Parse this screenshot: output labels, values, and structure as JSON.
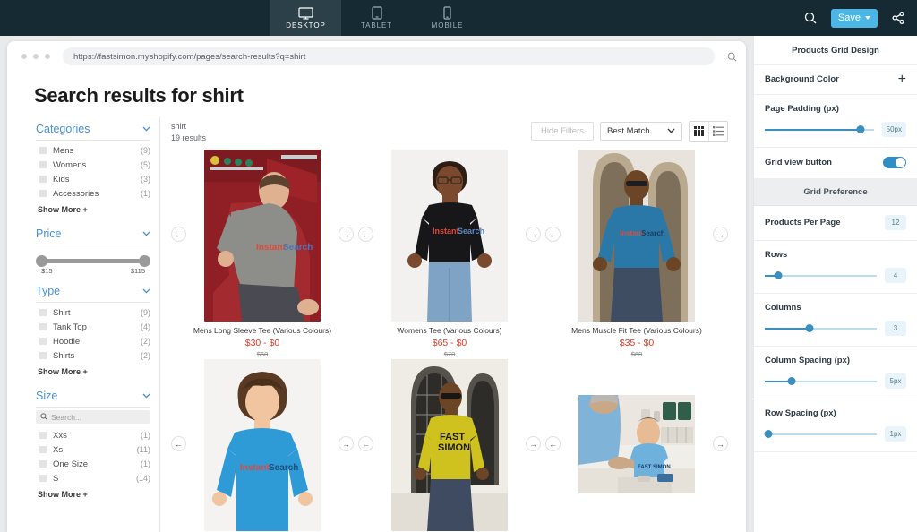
{
  "topbar": {
    "devices": [
      {
        "label": "DESKTOP",
        "icon": "desktop-icon",
        "active": true
      },
      {
        "label": "TABLET",
        "icon": "tablet-icon",
        "active": false
      },
      {
        "label": "MOBILE",
        "icon": "mobile-icon",
        "active": false
      }
    ],
    "search_icon": "search-icon",
    "save_label": "Save",
    "share_icon": "share-icon",
    "bg_color": "#152a33",
    "active_tab_color": "#2c4049",
    "save_color": "#4cb6e5"
  },
  "browser": {
    "url": "https://fastsimon.myshopify.com/pages/search-results?q=shirt",
    "search_icon": "search-icon"
  },
  "store": {
    "title": "Search results for shirt",
    "query": "shirt",
    "results_count": "19 results",
    "hide_filters_label": "Hide Filters",
    "sort_value": "Best Match",
    "view_grid_icon": "grid-view-icon",
    "view_list_icon": "list-view-icon",
    "filters": [
      {
        "name": "Categories",
        "type": "checkbox",
        "options": [
          {
            "label": "Mens",
            "count": "(9)"
          },
          {
            "label": "Womens",
            "count": "(5)"
          },
          {
            "label": "Kids",
            "count": "(3)"
          },
          {
            "label": "Accessories",
            "count": "(1)"
          }
        ],
        "show_more": "Show More +"
      },
      {
        "name": "Price",
        "type": "range",
        "min_label": "$15",
        "max_label": "$115"
      },
      {
        "name": "Type",
        "type": "checkbox",
        "options": [
          {
            "label": "Shirt",
            "count": "(9)"
          },
          {
            "label": "Tank Top",
            "count": "(4)"
          },
          {
            "label": "Hoodie",
            "count": "(2)"
          },
          {
            "label": "Shirts",
            "count": "(2)"
          }
        ],
        "show_more": "Show More +"
      },
      {
        "name": "Size",
        "type": "checkbox-search",
        "search_placeholder": "Search...",
        "options": [
          {
            "label": "Xxs",
            "count": "(1)"
          },
          {
            "label": "Xs",
            "count": "(11)"
          },
          {
            "label": "One Size",
            "count": "(1)"
          },
          {
            "label": "S",
            "count": "(14)"
          }
        ],
        "show_more": "Show More +"
      }
    ],
    "products": [
      {
        "title": "Mens Long Sleeve Tee (Various Colours)",
        "price": "$30 - $0",
        "old_price": "$60",
        "image": "man-grey-longsleeve-red-seats"
      },
      {
        "title": "Womens Tee (Various Colours)",
        "price": "$65 - $0",
        "old_price": "$70",
        "image": "woman-black-tee"
      },
      {
        "title": "Mens Muscle Fit Tee (Various Colours)",
        "price": "$35 - $0",
        "old_price": "$60",
        "image": "man-blue-tee-arches"
      },
      {
        "title": "",
        "price": "",
        "old_price": "",
        "image": "boy-blue-tee"
      },
      {
        "title": "",
        "price": "",
        "old_price": "",
        "image": "man-yellow-tee"
      },
      {
        "title": "",
        "price": "",
        "old_price": "",
        "image": "kid-and-adult-table"
      }
    ],
    "arrow_prev": "←",
    "arrow_next": "→",
    "price_color": "#e03b29"
  },
  "panel": {
    "title": "Products Grid Design",
    "background_color_label": "Background Color",
    "add_icon": "plus-icon",
    "page_padding_label": "Page Padding (px)",
    "page_padding_value": "50px",
    "page_padding_pct": 88,
    "grid_view_button_label": "Grid view button",
    "grid_view_button_on": true,
    "grid_preference_label": "Grid Preference",
    "products_per_page_label": "Products Per Page",
    "products_per_page_value": "12",
    "rows_label": "Rows",
    "rows_value": "4",
    "rows_pct": 12,
    "columns_label": "Columns",
    "columns_value": "3",
    "columns_pct": 40,
    "column_spacing_label": "Column Spacing (px)",
    "column_spacing_value": "5px",
    "column_spacing_pct": 24,
    "row_spacing_label": "Row Spacing (px)",
    "row_spacing_value": "1px",
    "row_spacing_pct": 3,
    "accent_color": "#3b8fbf"
  }
}
